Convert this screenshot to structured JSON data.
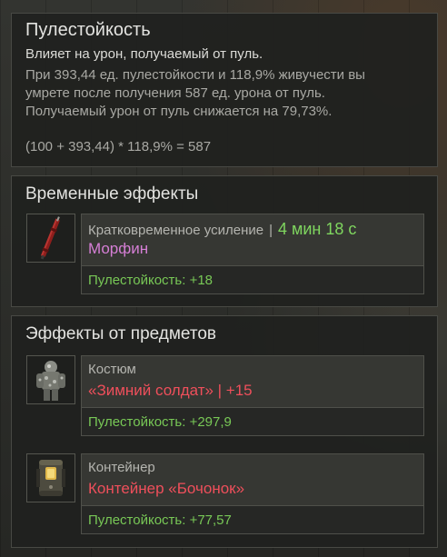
{
  "resist": {
    "title": "Пулестойкость",
    "desc_main": "Влияет на урон, получаемый от пуль.",
    "desc_line1": "При 393,44 ед. пулестойкости и 118,9% живучести вы",
    "desc_line2": "умрете после получения 587 ед. урона от пуль.",
    "desc_line3": "Получаемый урон от пуль снижается на 79,73%.",
    "formula": "(100 + 393,44) * 118,9% = 587"
  },
  "temp": {
    "title": "Временные эффекты",
    "entries": [
      {
        "icon": "morphine-syringe-icon",
        "label": "Кратковременное усиление",
        "separator": "|",
        "timer": "4 мин 18 с",
        "name": "Морфин",
        "stat": "Пулестойкость: +18"
      }
    ]
  },
  "items": {
    "title": "Эффекты от предметов",
    "entries": [
      {
        "icon": "winter-soldier-suit-icon",
        "label": "Костюм",
        "name": "«Зимний солдат» | +15",
        "stat": "Пулестойкость: +297,9"
      },
      {
        "icon": "barrel-container-icon",
        "label": "Контейнер",
        "name": "Контейнер «Бочонок»",
        "stat": "Пулестойкость: +77,57"
      }
    ]
  },
  "colors": {
    "stat_green": "#78c856",
    "timer_green": "#7fd65f",
    "morphine_pink": "#d67fd6",
    "item_red": "#ef4f5b"
  }
}
